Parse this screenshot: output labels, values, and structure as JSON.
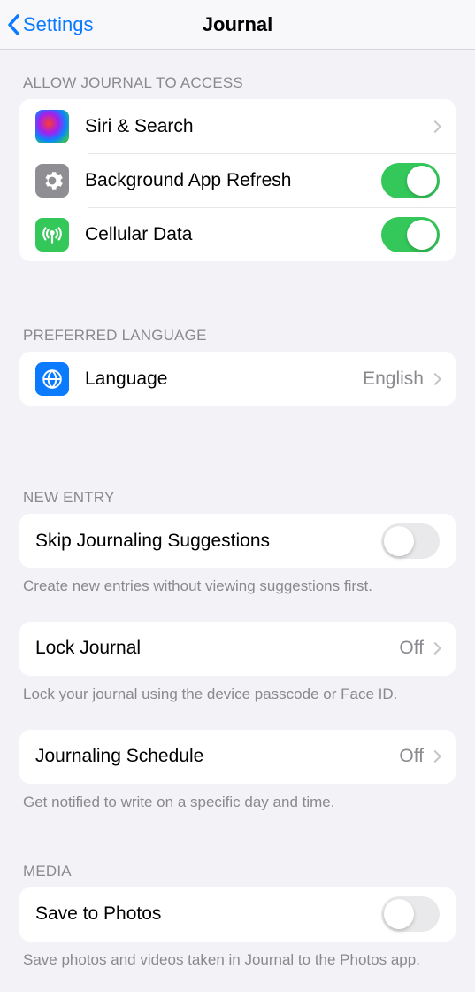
{
  "nav": {
    "back": "Settings",
    "title": "Journal"
  },
  "sections": {
    "access": {
      "header": "ALLOW JOURNAL TO ACCESS",
      "siri": "Siri & Search",
      "refresh": "Background App Refresh",
      "cellular": "Cellular Data"
    },
    "language": {
      "header": "PREFERRED LANGUAGE",
      "label": "Language",
      "value": "English"
    },
    "new_entry": {
      "header": "NEW ENTRY",
      "skip": "Skip Journaling Suggestions",
      "skip_footer": "Create new entries without viewing suggestions first.",
      "lock": "Lock Journal",
      "lock_value": "Off",
      "lock_footer": "Lock your journal using the device passcode or Face ID.",
      "schedule": "Journaling Schedule",
      "schedule_value": "Off",
      "schedule_footer": "Get notified to write on a specific day and time."
    },
    "media": {
      "header": "MEDIA",
      "save": "Save to Photos",
      "save_footer": "Save photos and videos taken in Journal to the Photos app."
    }
  },
  "toggles": {
    "refresh": true,
    "cellular": true,
    "skip": false,
    "save": false
  }
}
